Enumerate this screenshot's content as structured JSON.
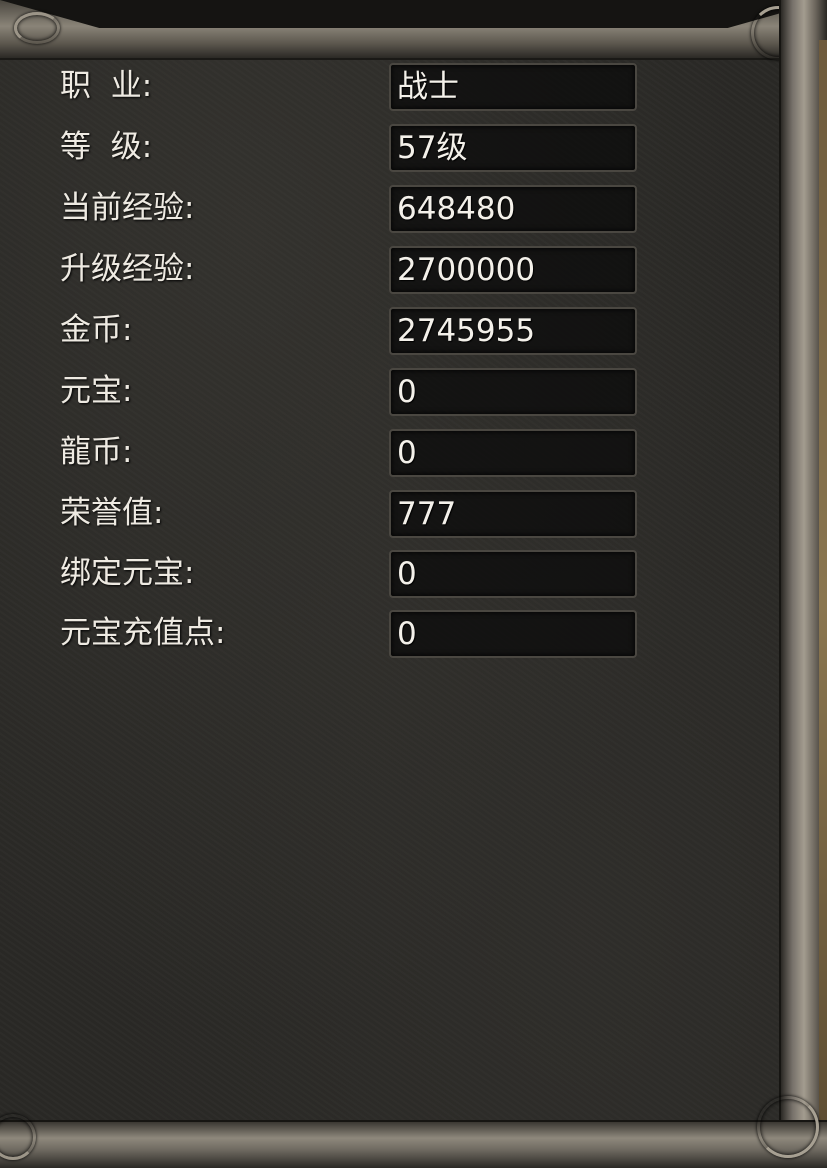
{
  "panel": {
    "title": "",
    "rows": [
      {
        "label": "职  业:",
        "value": "战士"
      },
      {
        "label": "等  级:",
        "value": "57级"
      },
      {
        "label": "当前经验:",
        "value": "648480"
      },
      {
        "label": "升级经验:",
        "value": "2700000"
      },
      {
        "label": "金币:",
        "value": "2745955"
      },
      {
        "label": "元宝:",
        "value": "0"
      },
      {
        "label": "龍币:",
        "value": "0"
      },
      {
        "label": "荣誉值:",
        "value": "777"
      },
      {
        "label": "绑定元宝:",
        "value": "0"
      },
      {
        "label": "元宝充值点:",
        "value": "0"
      }
    ]
  },
  "colors": {
    "background": "#2a2926",
    "label_text": "#eeeae2",
    "value_text": "#f4f1ea",
    "frame_stone": "#8a8478"
  }
}
